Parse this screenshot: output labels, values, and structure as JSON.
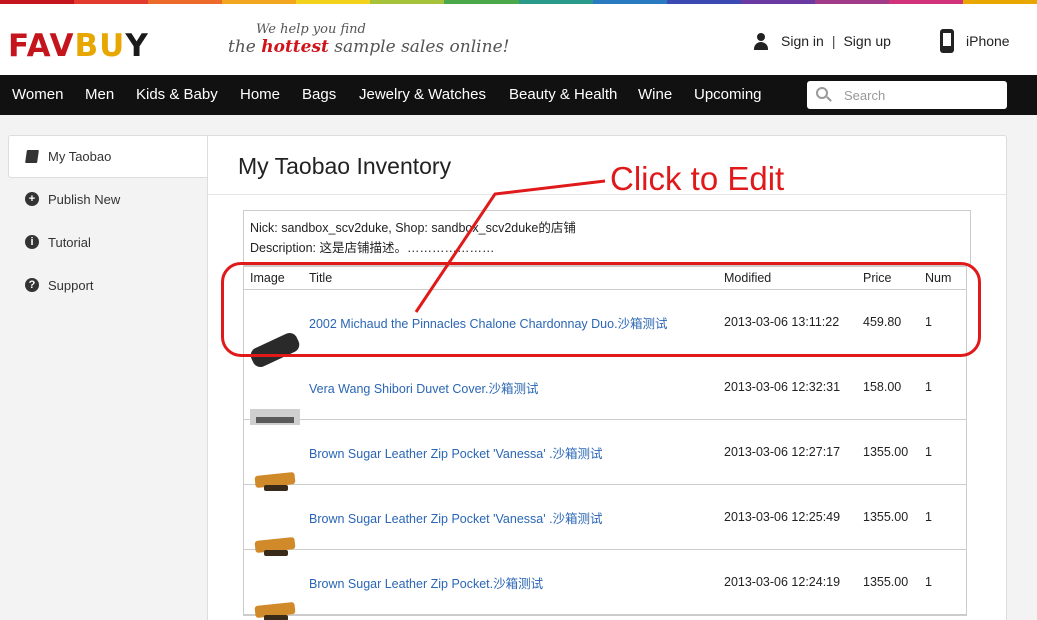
{
  "brand": {
    "logo_part1": "FAV",
    "logo_part2": "BU",
    "logo_part3": "Y",
    "tagline_line1": "We help you find",
    "tagline_line2_a": "the ",
    "tagline_line2_b": "hottest",
    "tagline_line2_c": " sample sales online!",
    "colors": {
      "accent_red": "#c4141c",
      "accent_gold": "#e8a600"
    },
    "rainbow_colors": [
      "#c4141c",
      "#e23a2e",
      "#ec6a2a",
      "#f2a51e",
      "#f2d21a",
      "#a6c23a",
      "#4aa84a",
      "#2a9a8a",
      "#2a7ac2",
      "#3a4ab2",
      "#6a3aa2",
      "#a23a8a",
      "#d2327a",
      "#e8a600"
    ]
  },
  "account": {
    "sign_in": "Sign in",
    "separator": "|",
    "sign_up": "Sign up",
    "iphone": "iPhone"
  },
  "nav": {
    "items": [
      "Women",
      "Men",
      "Kids & Baby",
      "Home",
      "Bags",
      "Jewelry & Watches",
      "Beauty & Health",
      "Wine",
      "Upcoming"
    ],
    "search_placeholder": "Search"
  },
  "sidebar": {
    "items": [
      {
        "label": "My Taobao",
        "icon": "book-icon",
        "active": true
      },
      {
        "label": "Publish New",
        "icon": "plus-circle-icon",
        "glyph": "+"
      },
      {
        "label": "Tutorial",
        "icon": "info-circle-icon",
        "glyph": "i"
      },
      {
        "label": "Support",
        "icon": "question-circle-icon",
        "glyph": "?"
      }
    ]
  },
  "main": {
    "title": "My Taobao Inventory",
    "shop_line1": "Nick: sandbox_scv2duke, Shop: sandbox_scv2duke的店铺",
    "shop_line2": "Description: 这是店铺描述。…………………",
    "columns": [
      "Image",
      "Title",
      "Modified",
      "Price",
      "Num"
    ],
    "rows": [
      {
        "thumb": "wine",
        "title": "2002 Michaud the Pinnacles Chalone Chardonnay Duo.沙箱测试",
        "modified": "2013-03-06 13:11:22",
        "price": "459.80",
        "num": "1"
      },
      {
        "thumb": "duvet",
        "title": "Vera Wang Shibori Duvet Cover.沙箱测试",
        "modified": "2013-03-06 12:32:31",
        "price": "158.00",
        "num": "1"
      },
      {
        "thumb": "bag",
        "title": "Brown Sugar Leather Zip Pocket 'Vanessa' .沙箱测试",
        "modified": "2013-03-06 12:27:17",
        "price": "1355.00",
        "num": "1"
      },
      {
        "thumb": "bag",
        "title": "Brown Sugar Leather Zip Pocket 'Vanessa' .沙箱测试",
        "modified": "2013-03-06 12:25:49",
        "price": "1355.00",
        "num": "1"
      },
      {
        "thumb": "bag",
        "title": "Brown Sugar Leather Zip Pocket.沙箱测试",
        "modified": "2013-03-06 12:24:19",
        "price": "1355.00",
        "num": "1"
      }
    ]
  },
  "annotation": {
    "text": "Click to Edit",
    "color": "#e01a1a"
  }
}
